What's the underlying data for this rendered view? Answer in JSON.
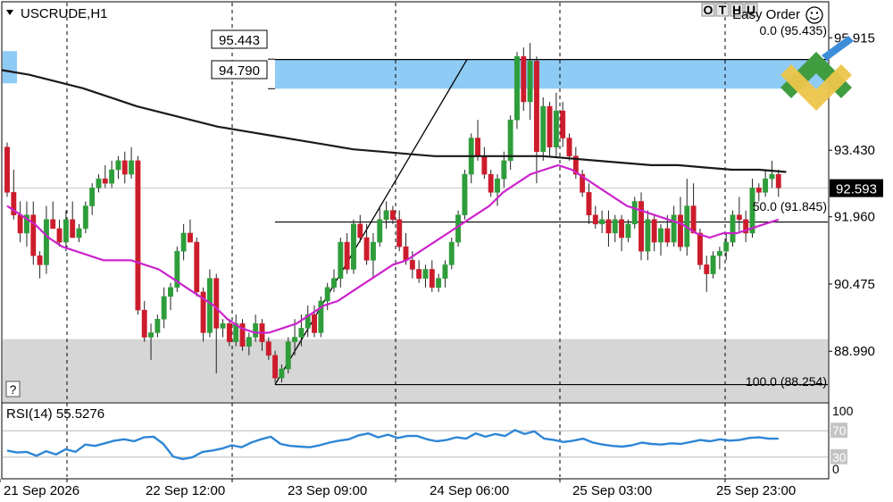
{
  "symbol_title": "USCRUDE,H1",
  "easy_order_label": "Easy Order",
  "toolbar_letters": [
    "O",
    "T",
    "H",
    "U"
  ],
  "help_button": "?",
  "price_labels": {
    "zone_top": "95.443",
    "zone_bottom": "94.790",
    "current": "92.593"
  },
  "fib_labels": {
    "level_0": "0.0 (95.435)",
    "level_50": "50.0 (91.845)",
    "level_100": "100.0 (88.254)"
  },
  "rsi_label": "RSI(14) 55.5276",
  "colors": {
    "bull": "#2e9d3a",
    "bear": "#cc1c2c",
    "ma_fast": "#cc22cc",
    "ma_slow": "#1a1a1a",
    "rsi": "#2e86d6",
    "supply_zone": "#8ecbf5",
    "demand_zone": "#d6d6d6",
    "current_price_bg": "#000000"
  },
  "chart_data": {
    "type": "candlestick",
    "instrument": "USCRUDE",
    "timeframe": "H1",
    "yaxis_ticks": [
      95.915,
      93.43,
      91.96,
      90.475,
      88.99
    ],
    "ylim": [
      87.87,
      96.69
    ],
    "xaxis_ticks": [
      "21 Sep 2026",
      "22 Sep 12:00",
      "23 Sep 09:00",
      "24 Sep 06:00",
      "25 Sep 03:00",
      "25 Sep 23:00"
    ],
    "current_price": 92.593,
    "candles": [
      [
        93.5,
        93.6,
        92.4,
        92.5
      ],
      [
        92.5,
        93.0,
        91.9,
        92.0
      ],
      [
        92.0,
        92.3,
        91.4,
        91.6
      ],
      [
        91.6,
        92.3,
        91.3,
        92.0
      ],
      [
        92.0,
        92.3,
        90.9,
        91.1
      ],
      [
        91.1,
        91.2,
        90.6,
        90.9
      ],
      [
        90.9,
        92.2,
        90.7,
        91.9
      ],
      [
        91.9,
        92.3,
        91.7,
        91.7
      ],
      [
        91.7,
        91.9,
        91.3,
        91.4
      ],
      [
        91.4,
        92.1,
        91.2,
        91.9
      ],
      [
        91.9,
        92.3,
        91.5,
        91.5
      ],
      [
        91.5,
        91.8,
        91.4,
        91.7
      ],
      [
        91.7,
        92.3,
        91.6,
        92.2
      ],
      [
        92.2,
        92.7,
        92.0,
        92.6
      ],
      [
        92.6,
        92.9,
        92.5,
        92.8
      ],
      [
        92.8,
        93.1,
        92.6,
        92.7
      ],
      [
        92.7,
        93.2,
        92.6,
        93.0
      ],
      [
        93.0,
        93.3,
        92.8,
        93.2
      ],
      [
        93.2,
        93.4,
        92.7,
        92.9
      ],
      [
        92.9,
        93.5,
        92.8,
        93.2
      ],
      [
        93.2,
        93.3,
        89.8,
        89.9
      ],
      [
        89.9,
        90.1,
        89.2,
        89.3
      ],
      [
        89.3,
        89.6,
        88.8,
        89.4
      ],
      [
        89.4,
        89.8,
        89.3,
        89.7
      ],
      [
        89.7,
        90.4,
        89.5,
        90.2
      ],
      [
        90.2,
        90.5,
        89.9,
        90.4
      ],
      [
        90.4,
        91.3,
        90.3,
        91.2
      ],
      [
        91.2,
        91.8,
        91.0,
        91.6
      ],
      [
        91.6,
        91.9,
        91.4,
        91.4
      ],
      [
        91.4,
        91.5,
        90.2,
        90.3
      ],
      [
        90.3,
        90.4,
        89.2,
        89.4
      ],
      [
        89.4,
        90.8,
        89.3,
        90.6
      ],
      [
        90.6,
        90.7,
        88.5,
        89.5
      ],
      [
        89.5,
        89.7,
        89.3,
        89.6
      ],
      [
        89.6,
        89.7,
        89.1,
        89.2
      ],
      [
        89.2,
        89.8,
        89.1,
        89.6
      ],
      [
        89.6,
        89.7,
        89.0,
        89.1
      ],
      [
        89.1,
        89.4,
        88.9,
        89.3
      ],
      [
        89.3,
        89.8,
        89.2,
        89.6
      ],
      [
        89.6,
        89.7,
        89.0,
        89.2
      ],
      [
        89.2,
        89.3,
        88.8,
        88.9
      ],
      [
        88.9,
        89.0,
        88.3,
        88.4
      ],
      [
        88.4,
        88.7,
        88.3,
        88.6
      ],
      [
        88.6,
        89.3,
        88.5,
        89.2
      ],
      [
        89.2,
        89.7,
        88.9,
        89.3
      ],
      [
        89.3,
        89.8,
        89.1,
        89.5
      ],
      [
        89.5,
        90.0,
        89.3,
        89.8
      ],
      [
        89.8,
        90.0,
        89.3,
        89.4
      ],
      [
        89.4,
        90.2,
        89.3,
        90.1
      ],
      [
        90.1,
        90.5,
        89.9,
        90.4
      ],
      [
        90.4,
        90.8,
        90.3,
        90.6
      ],
      [
        90.6,
        91.5,
        90.4,
        91.4
      ],
      [
        91.4,
        91.6,
        90.7,
        90.8
      ],
      [
        90.8,
        91.9,
        90.7,
        91.8
      ],
      [
        91.8,
        92.0,
        91.4,
        91.5
      ],
      [
        91.5,
        91.8,
        90.9,
        91.0
      ],
      [
        91.0,
        91.6,
        90.6,
        91.4
      ],
      [
        91.4,
        92.2,
        91.3,
        91.9
      ],
      [
        91.9,
        92.3,
        91.7,
        92.1
      ],
      [
        92.1,
        92.2,
        91.8,
        91.9
      ],
      [
        91.9,
        92.1,
        91.2,
        91.3
      ],
      [
        91.3,
        91.6,
        90.9,
        91.0
      ],
      [
        91.0,
        91.2,
        90.6,
        90.8
      ],
      [
        90.8,
        91.0,
        90.5,
        90.6
      ],
      [
        90.6,
        90.9,
        90.4,
        90.8
      ],
      [
        90.8,
        91.0,
        90.3,
        90.4
      ],
      [
        90.4,
        90.7,
        90.3,
        90.6
      ],
      [
        90.6,
        91.0,
        90.4,
        90.9
      ],
      [
        90.9,
        91.5,
        90.8,
        91.4
      ],
      [
        91.4,
        92.1,
        91.3,
        92.0
      ],
      [
        92.0,
        93.0,
        91.9,
        92.9
      ],
      [
        92.9,
        93.8,
        92.7,
        93.7
      ],
      [
        93.7,
        94.1,
        93.2,
        93.3
      ],
      [
        93.3,
        93.5,
        92.8,
        92.9
      ],
      [
        92.9,
        93.0,
        92.4,
        92.5
      ],
      [
        92.5,
        92.9,
        92.2,
        92.8
      ],
      [
        92.8,
        93.4,
        92.6,
        93.2
      ],
      [
        93.2,
        94.2,
        93.0,
        94.1
      ],
      [
        94.1,
        95.6,
        93.9,
        95.5
      ],
      [
        95.5,
        95.7,
        94.3,
        94.5
      ],
      [
        94.5,
        95.8,
        94.1,
        95.4
      ],
      [
        95.4,
        95.5,
        92.7,
        93.4
      ],
      [
        93.4,
        94.6,
        93.2,
        94.4
      ],
      [
        94.4,
        94.5,
        93.3,
        93.5
      ],
      [
        93.5,
        94.7,
        93.3,
        94.3
      ],
      [
        94.3,
        94.5,
        93.5,
        93.7
      ],
      [
        93.7,
        93.8,
        93.2,
        93.3
      ],
      [
        93.3,
        93.5,
        92.8,
        92.9
      ],
      [
        92.9,
        93.0,
        92.4,
        92.5
      ],
      [
        92.5,
        92.7,
        91.8,
        92.0
      ],
      [
        92.0,
        92.2,
        91.7,
        91.8
      ],
      [
        91.8,
        92.1,
        91.6,
        91.9
      ],
      [
        91.9,
        92.1,
        91.3,
        91.6
      ],
      [
        91.6,
        92.0,
        91.4,
        91.9
      ],
      [
        91.9,
        92.0,
        91.2,
        91.5
      ],
      [
        91.5,
        91.9,
        91.4,
        91.8
      ],
      [
        91.8,
        92.4,
        91.7,
        92.3
      ],
      [
        92.3,
        92.5,
        91.0,
        91.2
      ],
      [
        91.2,
        92.1,
        91.0,
        91.9
      ],
      [
        91.9,
        92.0,
        91.2,
        91.4
      ],
      [
        91.4,
        91.8,
        91.1,
        91.7
      ],
      [
        91.7,
        92.0,
        91.3,
        91.4
      ],
      [
        91.4,
        92.2,
        91.3,
        92.0
      ],
      [
        92.0,
        92.4,
        91.2,
        91.3
      ],
      [
        91.3,
        92.8,
        91.1,
        92.2
      ],
      [
        92.2,
        92.7,
        91.6,
        91.6
      ],
      [
        91.6,
        91.7,
        90.8,
        90.9
      ],
      [
        90.9,
        91.1,
        90.3,
        90.7
      ],
      [
        90.7,
        91.2,
        90.6,
        91.1
      ],
      [
        91.1,
        91.3,
        90.8,
        91.2
      ],
      [
        91.2,
        91.6,
        91.0,
        91.4
      ],
      [
        91.4,
        92.1,
        91.3,
        92.0
      ],
      [
        92.0,
        92.4,
        91.6,
        91.9
      ],
      [
        91.9,
        92.1,
        91.4,
        91.6
      ],
      [
        91.6,
        92.8,
        91.5,
        92.6
      ],
      [
        92.6,
        92.7,
        92.3,
        92.5
      ],
      [
        92.5,
        93.0,
        92.4,
        92.8
      ],
      [
        92.8,
        93.2,
        92.6,
        92.9
      ],
      [
        92.9,
        93.0,
        92.4,
        92.6
      ]
    ],
    "series": [
      {
        "values": [
          92.2,
          92.0,
          91.8,
          91.5,
          91.3,
          91.2,
          91.1,
          91.0,
          91.0,
          91.0,
          90.9,
          90.8,
          90.6,
          90.4,
          90.2,
          90.0,
          89.7,
          89.5,
          89.4,
          89.4,
          89.5,
          89.6,
          89.8,
          90.0,
          90.1,
          90.3,
          90.5,
          90.7,
          90.9,
          91.0,
          91.2,
          91.4,
          91.6,
          91.8,
          92.0,
          92.2,
          92.5,
          92.7,
          92.9,
          93.0,
          93.1,
          93.0,
          92.8,
          92.6,
          92.4,
          92.2,
          92.1,
          92.0,
          91.9,
          91.8,
          91.6,
          91.5,
          91.6,
          91.6,
          91.7,
          91.8,
          91.9
        ]
      },
      {
        "values": [
          95.2,
          95.1,
          94.95,
          94.8,
          94.6,
          94.4,
          94.25,
          94.1,
          93.95,
          93.85,
          93.75,
          93.65,
          93.55,
          93.45,
          93.4,
          93.35,
          93.3,
          93.3,
          93.3,
          93.3,
          93.3,
          93.25,
          93.2,
          93.15,
          93.1,
          93.1,
          93.05,
          93.0,
          93.0,
          92.95
        ]
      }
    ],
    "rsi": {
      "values": [
        40,
        37,
        38,
        32,
        39,
        34,
        42,
        38,
        49,
        47,
        51,
        55,
        57,
        54,
        60,
        61,
        50,
        31,
        27,
        30,
        38,
        40,
        43,
        48,
        45,
        52,
        57,
        61,
        50,
        47,
        46,
        45,
        48,
        52,
        55,
        57,
        63,
        66,
        60,
        64,
        59,
        62,
        62,
        57,
        54,
        56,
        60,
        58,
        66,
        61,
        65,
        62,
        71,
        65,
        69,
        58,
        56,
        53,
        55,
        58,
        52,
        49,
        47,
        46,
        48,
        52,
        50,
        49,
        51,
        50,
        53,
        56,
        54,
        57,
        55,
        56,
        59,
        60,
        58,
        58
      ]
    },
    "rsi_levels": [
      70,
      30
    ],
    "rsi_axis": [
      100,
      70,
      30,
      0
    ],
    "fibonacci": [
      {
        "level": "0.0",
        "price": 95.435
      },
      {
        "level": "50.0",
        "price": 91.845
      },
      {
        "level": "100.0",
        "price": 88.254
      }
    ],
    "zones": {
      "supply": [
        94.79,
        95.443
      ],
      "demand": [
        88.254,
        89.1
      ]
    }
  }
}
